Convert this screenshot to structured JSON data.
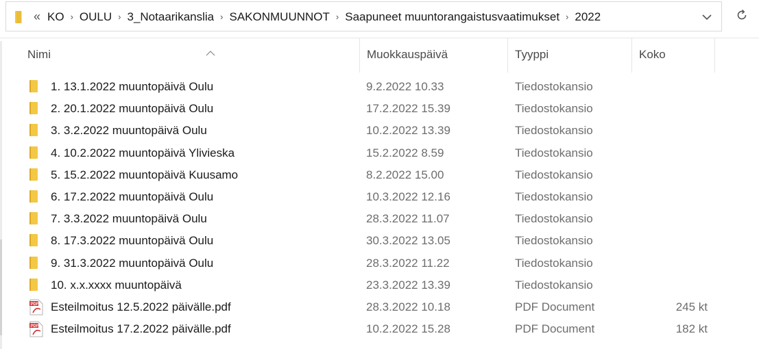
{
  "address_bar": {
    "overflow_glyph": "«",
    "separator": "›",
    "segments": [
      "KO",
      "OULU",
      "3_Notaarikanslia",
      "SAKONMUUNNOT",
      "Saapuneet muuntorangaistusvaatimukset",
      "2022"
    ]
  },
  "columns": {
    "name": "Nimi",
    "date": "Muokkauspäivä",
    "type": "Tyyppi",
    "size": "Koko"
  },
  "files": [
    {
      "name": "1. 13.1.2022 muuntopäivä Oulu",
      "date": "9.2.2022 10.33",
      "type": "Tiedostokansio",
      "size": "",
      "icon": "folder-icon"
    },
    {
      "name": "2. 20.1.2022 muuntopäivä Oulu",
      "date": "17.2.2022 15.39",
      "type": "Tiedostokansio",
      "size": "",
      "icon": "folder-icon"
    },
    {
      "name": "3. 3.2.2022 muuntopäivä Oulu",
      "date": "10.2.2022 13.39",
      "type": "Tiedostokansio",
      "size": "",
      "icon": "folder-icon"
    },
    {
      "name": "4. 10.2.2022 muuntopäivä Ylivieska",
      "date": "15.2.2022 8.59",
      "type": "Tiedostokansio",
      "size": "",
      "icon": "folder-icon"
    },
    {
      "name": "5. 15.2.2022 muuntopäivä Kuusamo",
      "date": "8.2.2022 15.00",
      "type": "Tiedostokansio",
      "size": "",
      "icon": "folder-icon"
    },
    {
      "name": "6. 17.2.2022 muuntopäivä Oulu",
      "date": "10.3.2022 12.16",
      "type": "Tiedostokansio",
      "size": "",
      "icon": "folder-icon"
    },
    {
      "name": "7. 3.3.2022 muuntopäivä Oulu",
      "date": "28.3.2022 11.07",
      "type": "Tiedostokansio",
      "size": "",
      "icon": "folder-icon"
    },
    {
      "name": "8. 17.3.2022 muuntopäivä Oulu",
      "date": "30.3.2022 13.05",
      "type": "Tiedostokansio",
      "size": "",
      "icon": "folder-icon"
    },
    {
      "name": "9. 31.3.2022 muuntopäivä Oulu",
      "date": "28.3.2022 11.22",
      "type": "Tiedostokansio",
      "size": "",
      "icon": "folder-icon"
    },
    {
      "name": "10. x.x.xxxx muuntopäivä",
      "date": "23.3.2022 13.39",
      "type": "Tiedostokansio",
      "size": "",
      "icon": "folder-icon"
    },
    {
      "name": "Esteilmoitus 12.5.2022 päivälle.pdf",
      "date": "28.3.2022 10.18",
      "type": "PDF Document",
      "size": "245 kt",
      "icon": "pdf-icon"
    },
    {
      "name": "Esteilmoitus 17.2.2022 päivälle.pdf",
      "date": "10.2.2022 15.28",
      "type": "PDF Document",
      "size": "182 kt",
      "icon": "pdf-icon"
    }
  ],
  "colors": {
    "folder": "#f3c845",
    "folder_dark": "#dba824",
    "pdf_red": "#d32f2f",
    "secondary_text": "#6d6d6d"
  }
}
